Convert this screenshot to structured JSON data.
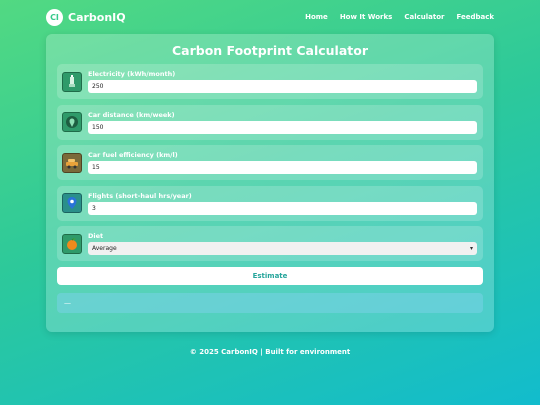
{
  "header": {
    "logo_text": "CI",
    "brand": "CarbonIQ",
    "nav": [
      "Home",
      "How It Works",
      "Calculator",
      "Feedback"
    ]
  },
  "calculator": {
    "title": "Carbon Footprint Calculator",
    "fields": [
      {
        "label": "Electricity (kWh/month)",
        "value": "250",
        "icon": "power-plant-icon"
      },
      {
        "label": "Car distance (km/week)",
        "value": "150",
        "icon": "map-pin-icon"
      },
      {
        "label": "Car fuel efficiency (km/l)",
        "value": "15",
        "icon": "fuel-car-icon"
      },
      {
        "label": "Flights (short-haul hrs/year)",
        "value": "3",
        "icon": "location-pin-icon"
      },
      {
        "label": "Diet",
        "value": "Average",
        "icon": "orange-fruit-icon"
      }
    ],
    "estimate_label": "Estimate",
    "result_text": "—"
  },
  "footer": {
    "text": "© 2025 CarbonIQ | Built for environment"
  },
  "colors": {
    "gradient_start": "#52d982",
    "gradient_end": "#12bccd",
    "button_text": "#26a59b"
  }
}
